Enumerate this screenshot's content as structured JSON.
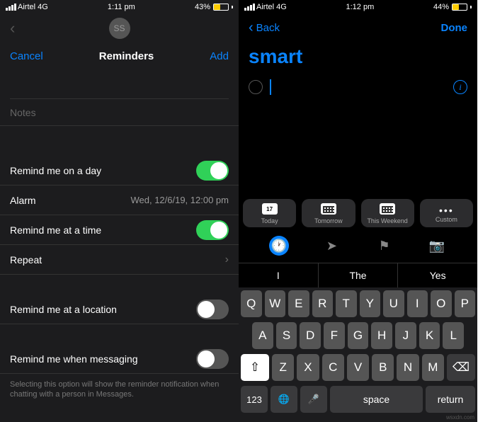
{
  "left": {
    "status": {
      "carrier": "Airtel 4G",
      "time": "1:11 pm",
      "battery": "43%"
    },
    "avatar": "SS",
    "nav": {
      "cancel": "Cancel",
      "title": "Reminders",
      "add": "Add"
    },
    "notes": "Notes",
    "rows": {
      "remindDay": "Remind me on a day",
      "alarm": {
        "label": "Alarm",
        "value": "Wed, 12/6/19, 12:00 pm"
      },
      "remindTime": "Remind me at a time",
      "repeat": "Repeat",
      "remindLocation": "Remind me at a location",
      "remindMessaging": "Remind me when messaging"
    },
    "footer": "Selecting this option will show the reminder notification when chatting with a person in Messages."
  },
  "right": {
    "status": {
      "carrier": "Airtel 4G",
      "time": "1:12 pm",
      "battery": "44%"
    },
    "nav": {
      "back": "Back",
      "done": "Done"
    },
    "title": "smart",
    "quick": {
      "today": "Today",
      "tomorrow": "Tomorrow",
      "weekend": "This Weekend",
      "custom": "Custom",
      "todayDate": "17"
    },
    "suggestions": [
      "I",
      "The",
      "Yes"
    ],
    "keyboard": {
      "row1": [
        "Q",
        "W",
        "E",
        "R",
        "T",
        "Y",
        "U",
        "I",
        "O",
        "P"
      ],
      "row2": [
        "A",
        "S",
        "D",
        "F",
        "G",
        "H",
        "J",
        "K",
        "L"
      ],
      "row3": [
        "Z",
        "X",
        "C",
        "V",
        "B",
        "N",
        "M"
      ],
      "num": "123",
      "space": "space",
      "return": "return"
    }
  },
  "watermark": "wsxdn.com"
}
